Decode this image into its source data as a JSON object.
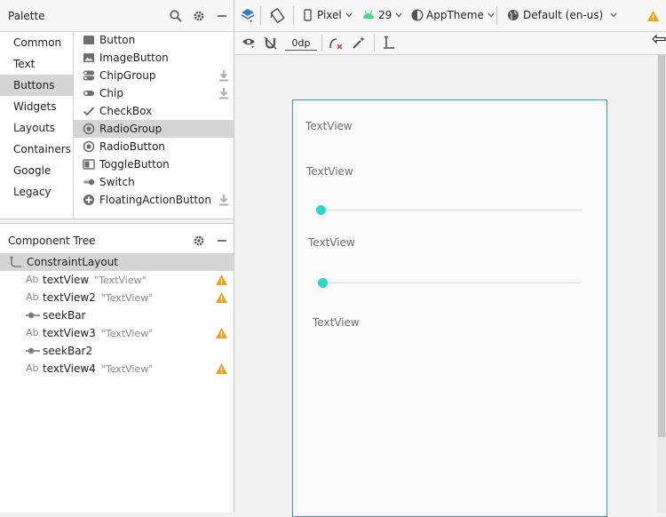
{
  "palette": {
    "title": "Palette",
    "categories": [
      "Common",
      "Text",
      "Buttons",
      "Widgets",
      "Layouts",
      "Containers",
      "Google",
      "Legacy"
    ],
    "selected_category": "Buttons",
    "items": [
      {
        "label": "Button",
        "icon": "button-icon",
        "download": false
      },
      {
        "label": "ImageButton",
        "icon": "image-button-icon",
        "download": false
      },
      {
        "label": "ChipGroup",
        "icon": "chip-group-icon",
        "download": true
      },
      {
        "label": "Chip",
        "icon": "chip-icon",
        "download": true
      },
      {
        "label": "CheckBox",
        "icon": "checkbox-icon",
        "download": false
      },
      {
        "label": "RadioGroup",
        "icon": "radio-group-icon",
        "download": false
      },
      {
        "label": "RadioButton",
        "icon": "radio-button-icon",
        "download": false
      },
      {
        "label": "ToggleButton",
        "icon": "toggle-button-icon",
        "download": false
      },
      {
        "label": "Switch",
        "icon": "switch-icon",
        "download": false
      },
      {
        "label": "FloatingActionButton",
        "icon": "fab-icon",
        "download": true
      }
    ],
    "selected_item": "RadioGroup"
  },
  "component_tree": {
    "title": "Component Tree",
    "root": "ConstraintLayout",
    "nodes": [
      {
        "prefix": "Ab",
        "name": "textView",
        "text": "\"TextView\"",
        "warning": true,
        "kind": "text"
      },
      {
        "prefix": "Ab",
        "name": "textView2",
        "text": "\"TextView\"",
        "warning": true,
        "kind": "text"
      },
      {
        "prefix": "",
        "name": "seekBar",
        "text": "",
        "warning": false,
        "kind": "seek"
      },
      {
        "prefix": "Ab",
        "name": "textView3",
        "text": "\"TextView\"",
        "warning": true,
        "kind": "text"
      },
      {
        "prefix": "",
        "name": "seekBar2",
        "text": "",
        "warning": false,
        "kind": "seek"
      },
      {
        "prefix": "Ab",
        "name": "textView4",
        "text": "\"TextView\"",
        "warning": true,
        "kind": "text"
      }
    ]
  },
  "toolbar": {
    "device": "Pixel",
    "api": "29",
    "theme": "AppTheme",
    "locale": "Default (en-us)",
    "margin": "0dp"
  },
  "canvas": {
    "views": [
      {
        "type": "text",
        "text": "TextView"
      },
      {
        "type": "text",
        "text": "TextView"
      },
      {
        "type": "seek"
      },
      {
        "type": "text",
        "text": "TextView"
      },
      {
        "type": "seek"
      },
      {
        "type": "text",
        "text": "TextView"
      }
    ]
  },
  "colors": {
    "accent": "#3b8fd6",
    "seek_thumb": "#2fd6c9",
    "warning": "#e8a317",
    "android_green": "#3ddc84"
  }
}
